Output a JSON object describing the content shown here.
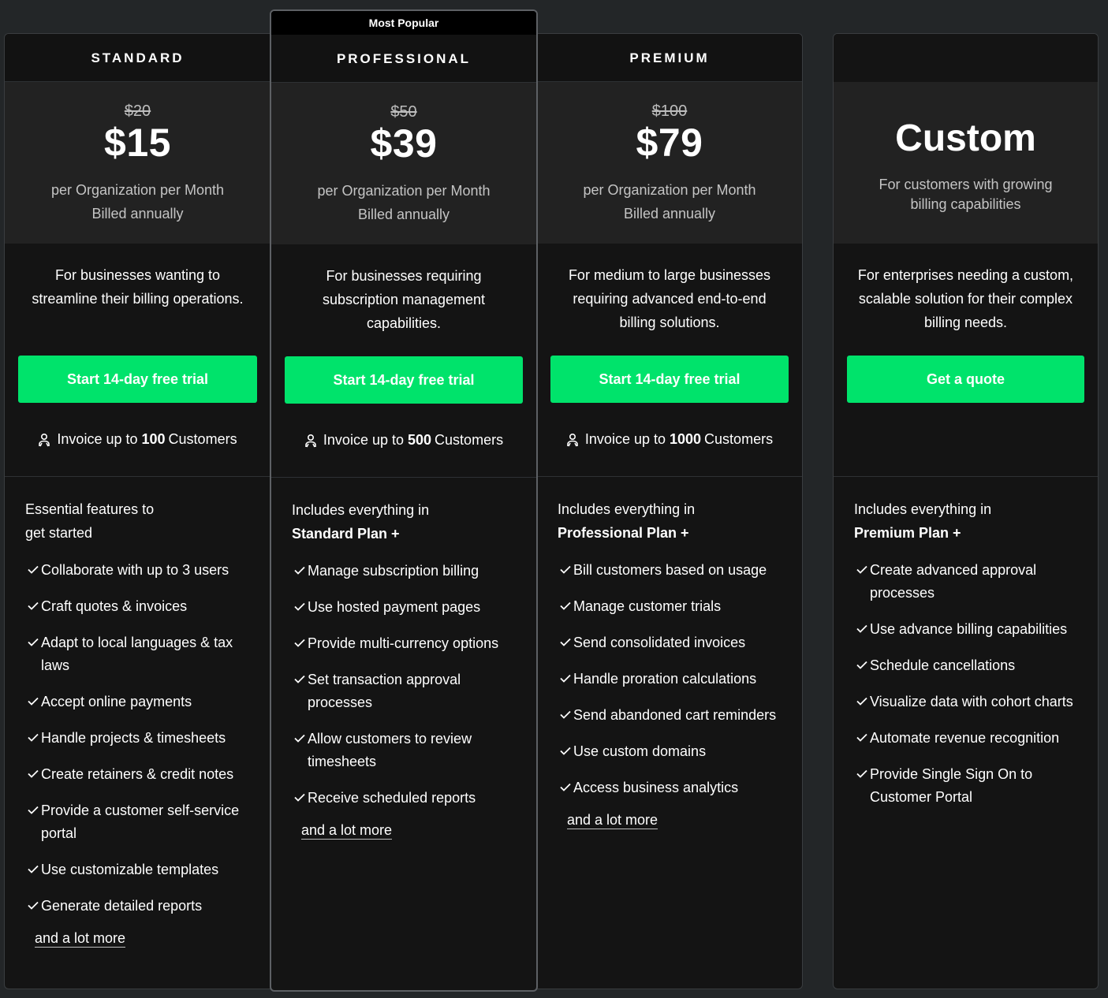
{
  "plans": [
    {
      "name": "STANDARD",
      "old_price": "$20",
      "price": "$15",
      "price_line1": "per Organization per Month",
      "price_line2": "Billed annually",
      "description": "For businesses wanting to streamline their billing operations.",
      "cta": "Start 14-day free trial",
      "limit_prefix": "Invoice up to",
      "limit_value": "100",
      "limit_suffix": "Customers",
      "intro_line1": "Essential features to",
      "intro_line2": "get started",
      "features": [
        "Collaborate with up to 3 users",
        "Craft quotes & invoices",
        "Adapt to local languages & tax laws",
        "Accept online payments",
        "Handle projects & timesheets",
        "Create retainers & credit notes",
        "Provide a customer self-service portal",
        "Use customizable templates",
        "Generate detailed reports"
      ],
      "more": "and a lot more"
    },
    {
      "badge": "Most Popular",
      "name": "PROFESSIONAL",
      "old_price": "$50",
      "price": "$39",
      "price_line1": "per Organization per Month",
      "price_line2": "Billed annually",
      "description": "For businesses requiring subscription management capabilities.",
      "cta": "Start 14-day free trial",
      "limit_prefix": "Invoice up to",
      "limit_value": "500",
      "limit_suffix": "Customers",
      "intro_line1": "Includes everything in",
      "intro_line2": "Standard Plan +",
      "features": [
        "Manage subscription billing",
        "Use hosted payment pages",
        "Provide multi-currency options",
        "Set transaction approval processes",
        "Allow customers to review timesheets",
        "Receive scheduled reports"
      ],
      "more": "and a lot more"
    },
    {
      "name": "PREMIUM",
      "old_price": "$100",
      "price": "$79",
      "price_line1": "per Organization per Month",
      "price_line2": "Billed annually",
      "description": "For medium to large businesses requiring advanced end-to-end billing solutions.",
      "cta": "Start 14-day free trial",
      "limit_prefix": "Invoice up to",
      "limit_value": "1000",
      "limit_suffix": "Customers",
      "intro_line1": "Includes everything in",
      "intro_line2": "Professional Plan +",
      "features": [
        "Bill customers based on usage",
        "Manage customer trials",
        "Send consolidated invoices",
        "Handle proration calculations",
        "Send abandoned cart reminders",
        "Use custom domains",
        "Access business analytics"
      ],
      "more": "and a lot more"
    },
    {
      "title": "Custom",
      "subtitle": "For customers with growing billing capabilities",
      "description": "For enterprises needing a custom, scalable solution for their complex billing needs.",
      "cta": "Get a quote",
      "intro_line1": "Includes everything in",
      "intro_line2": "Premium Plan +",
      "features": [
        "Create advanced approval processes",
        "Use advance billing capabilities",
        "Schedule cancellations",
        "Visualize data with cohort charts",
        "Automate revenue recognition",
        "Provide Single Sign On to Customer Portal"
      ]
    }
  ],
  "colors": {
    "accent": "#00e36b",
    "background": "#232628",
    "card": "#141414",
    "price_panel": "#222222"
  },
  "icons": [
    "user-icon",
    "check-icon"
  ]
}
